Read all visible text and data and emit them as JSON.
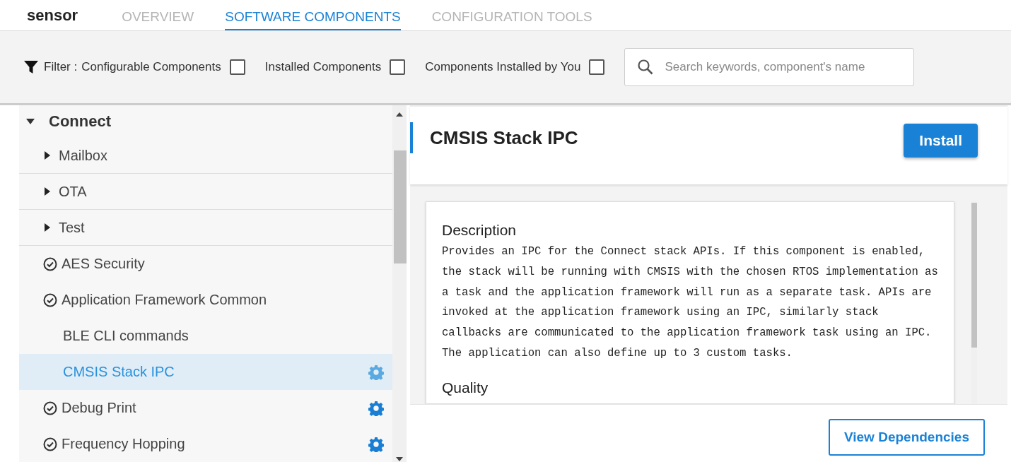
{
  "project": {
    "name": "sensor"
  },
  "tabs": [
    {
      "label": "OVERVIEW",
      "selected": false
    },
    {
      "label": "SOFTWARE COMPONENTS",
      "selected": true
    },
    {
      "label": "CONFIGURATION TOOLS",
      "selected": false
    }
  ],
  "filter": {
    "label": "Filter :",
    "options": [
      {
        "label": "Configurable Components",
        "checked": false
      },
      {
        "label": "Installed Components",
        "checked": false
      },
      {
        "label": "Components Installed by You",
        "checked": false
      }
    ],
    "search": {
      "placeholder": "Search keywords, component's name"
    }
  },
  "tree": [
    {
      "kind": "folder",
      "label": "Connect",
      "expanded": true,
      "children": [
        {
          "kind": "folder",
          "label": "Mailbox",
          "expanded": false
        },
        {
          "kind": "folder",
          "label": "OTA",
          "expanded": false
        },
        {
          "kind": "folder",
          "label": "Test",
          "expanded": false
        },
        {
          "kind": "component",
          "label": "AES Security",
          "installed": true,
          "configurable": false,
          "selected": false
        },
        {
          "kind": "component",
          "label": "Application Framework Common",
          "installed": true,
          "configurable": false,
          "selected": false
        },
        {
          "kind": "component",
          "label": "BLE CLI commands",
          "installed": false,
          "configurable": false,
          "selected": false
        },
        {
          "kind": "component",
          "label": "CMSIS Stack IPC",
          "installed": false,
          "configurable": true,
          "selected": true
        },
        {
          "kind": "component",
          "label": "Debug Print",
          "installed": true,
          "configurable": true,
          "selected": false
        },
        {
          "kind": "component",
          "label": "Frequency Hopping",
          "installed": true,
          "configurable": true,
          "selected": false
        }
      ]
    }
  ],
  "detail": {
    "title": "CMSIS Stack IPC",
    "install_button": "Install",
    "sections": [
      {
        "heading": "Description",
        "body": "Provides an IPC for the Connect stack APIs. If this component is enabled, the stack will be running with CMSIS with the chosen RTOS implementation as a task and the application framework will run as a separate task. APIs are invoked at the application framework using an IPC, similarly stack callbacks are communicated to the application framework task using an IPC. The application can also define up to 3 custom tasks."
      },
      {
        "heading": "Quality"
      }
    ],
    "footer_button": "View Dependencies"
  }
}
